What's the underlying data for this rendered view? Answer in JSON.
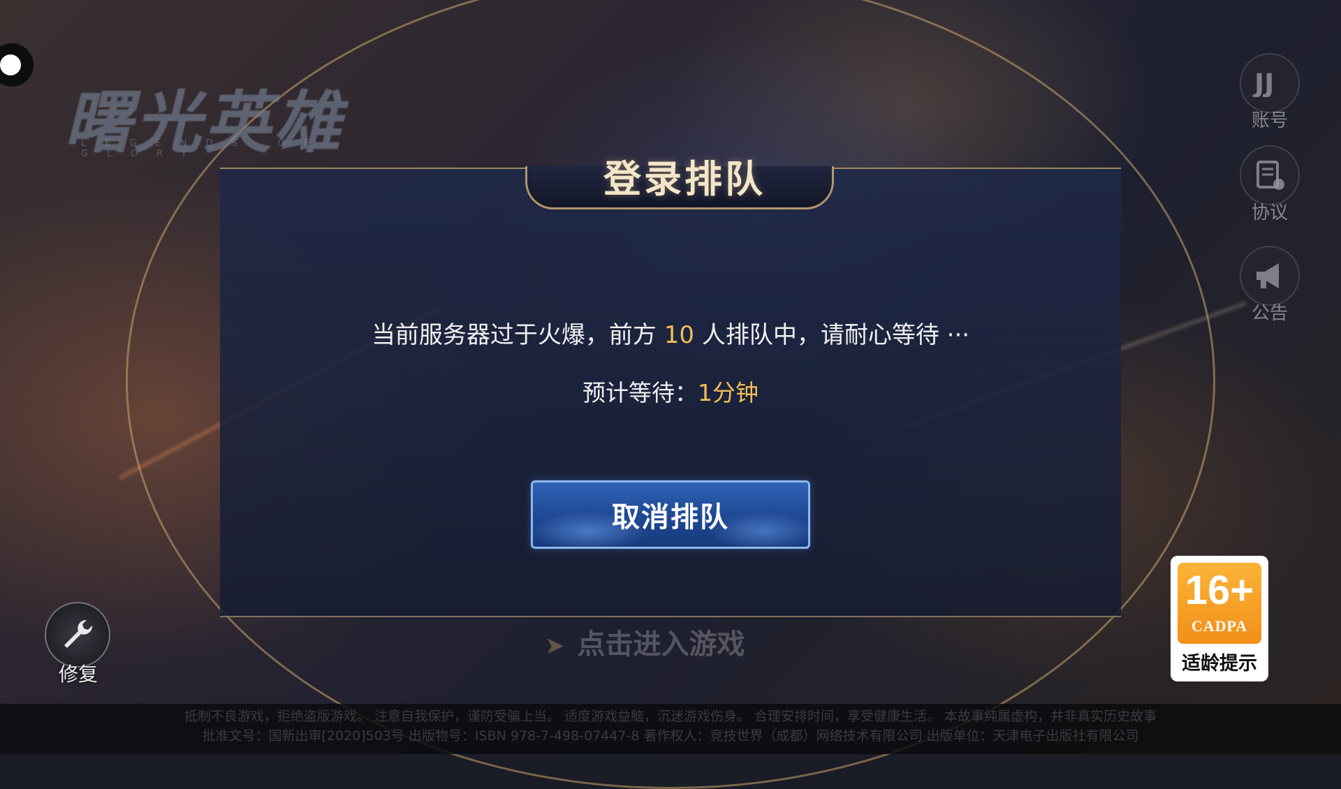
{
  "background": {
    "legal_line_1": "抵制不良游戏，拒绝盗版游戏。 注意自我保护，谨防受骗上当。 适度游戏益脑，沉迷游戏伤身。 合理安排时间，享受健康生活。 本故事纯属虚构，并非真实历史故事",
    "legal_line_2": "批准文号：国新出审[2020]503号  出版物号：ISBN 978-7-498-07447-8  著作权人：竞技世界（成都）网络技术有限公司  出版单位：天津电子出版社有限公司"
  },
  "logo": {
    "title": "曙光英雄",
    "subtitle": "LEGENDS OF GLORY"
  },
  "side_menu": {
    "account": {
      "icon": "account-icon",
      "label": "账号"
    },
    "agreement": {
      "icon": "agreement-icon",
      "label": "协议"
    },
    "notice": {
      "icon": "megaphone-icon",
      "label": "公告"
    }
  },
  "dialog": {
    "title": "登录排队",
    "message_prefix": "当前服务器过于火爆，前方 ",
    "queue_count": "10",
    "message_suffix": " 人排队中，请耐心等待 ···",
    "wait_label": "预计等待：",
    "wait_value": "1分钟",
    "cancel_button": "取消排队"
  },
  "enter_game": {
    "label": "点击进入游戏"
  },
  "repair": {
    "icon": "wrench-icon",
    "label": "修复"
  },
  "age_rating": {
    "rating": "16+",
    "org": "CADPA",
    "label": "适龄提示"
  },
  "colors": {
    "highlight": "#f2be55",
    "gold_border": "#d2af73",
    "button_blue": "#2f63b6",
    "age_orange": "#f6a02a"
  }
}
